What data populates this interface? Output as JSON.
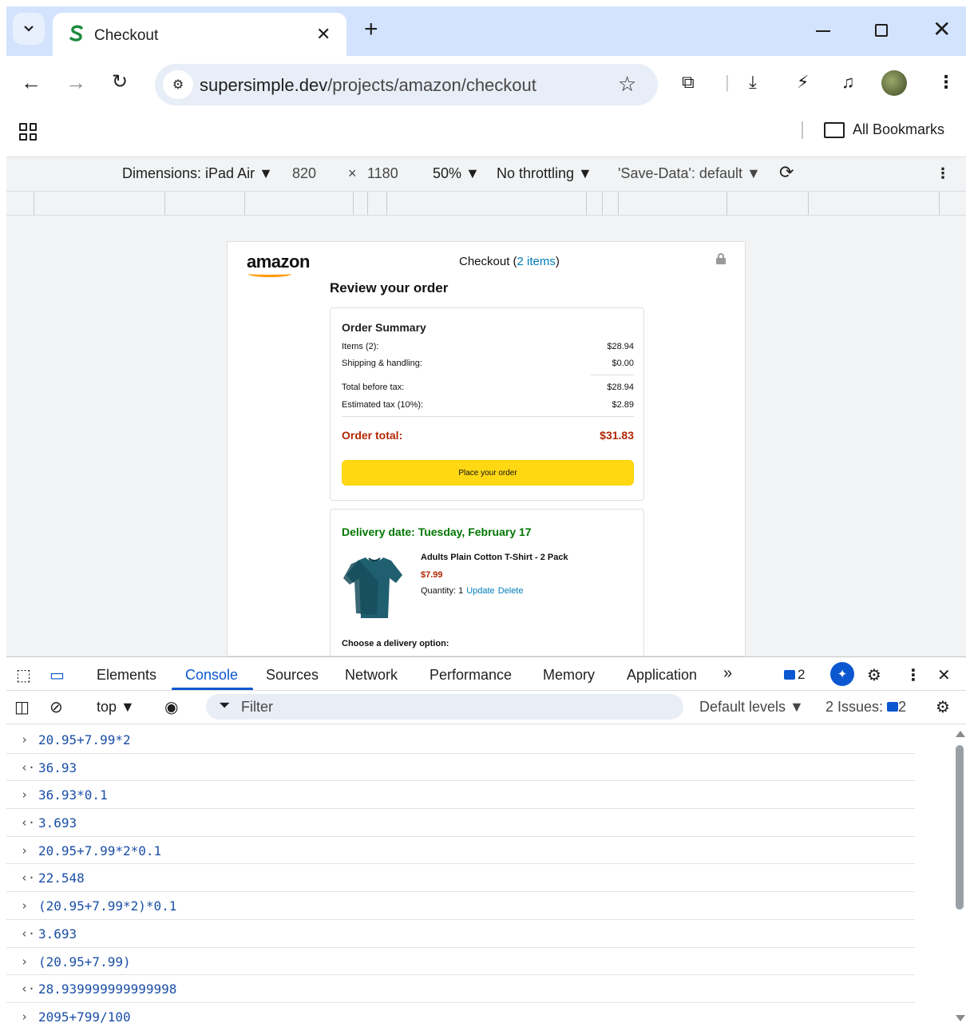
{
  "browser": {
    "tab_title": "Checkout",
    "url_host": "supersimple.dev",
    "url_path": "/projects/amazon/checkout",
    "bookmarks_label": "All Bookmarks"
  },
  "device_toolbar": {
    "dimensions_label": "Dimensions: iPad Air ▼",
    "width": "820",
    "times": "×",
    "height": "1180",
    "zoom": "50% ▼",
    "throttling": "No throttling ▼",
    "save_data": "'Save-Data': default ▼"
  },
  "page": {
    "logo": "amazon",
    "checkout_label": "Checkout (",
    "item_count": "2 items",
    "checkout_close": ")",
    "review_title": "Review your order",
    "summary": {
      "title": "Order Summary",
      "items_label": "Items (2):",
      "items_value": "$28.94",
      "shipping_label": "Shipping & handling:",
      "shipping_value": "$0.00",
      "before_tax_label": "Total before tax:",
      "before_tax_value": "$28.94",
      "tax_label": "Estimated tax (10%):",
      "tax_value": "$2.89",
      "total_label": "Order total:",
      "total_value": "$31.83",
      "place_order": "Place your order"
    },
    "delivery": {
      "date": "Delivery date: Tuesday, February 17",
      "product_name": "Adults Plain Cotton T-Shirt - 2 Pack",
      "price": "$7.99",
      "quantity": "Quantity: 1",
      "update": "Update",
      "delete": "Delete",
      "choose": "Choose a delivery option:"
    }
  },
  "devtools": {
    "tabs": [
      "Elements",
      "Console",
      "Sources",
      "Network",
      "Performance",
      "Memory",
      "Application"
    ],
    "more": "»",
    "issues_count": "2",
    "context": "top ▼",
    "filter_placeholder": "Filter",
    "levels": "Default levels ▼",
    "issues_label": "2 Issues:",
    "issues_badge": "2",
    "console_lines": [
      {
        "type": "input",
        "text": "20.95+7.99*2"
      },
      {
        "type": "output",
        "text": "36.93"
      },
      {
        "type": "input",
        "text": "36.93*0.1"
      },
      {
        "type": "output",
        "text": "3.693"
      },
      {
        "type": "input",
        "text": "20.95+7.99*2*0.1"
      },
      {
        "type": "output",
        "text": "22.548"
      },
      {
        "type": "input",
        "text": "(20.95+7.99*2)*0.1"
      },
      {
        "type": "output",
        "text": "3.693"
      },
      {
        "type": "input",
        "text": "(20.95+7.99)"
      },
      {
        "type": "output",
        "text": "28.939999999999998"
      },
      {
        "type": "input",
        "text": "2095+799/100"
      }
    ]
  },
  "colors": {
    "accent_blue": "#0b57d0",
    "order_total_red": "#b12704",
    "delivery_green": "#007600",
    "place_order_yellow": "#ffd814"
  }
}
